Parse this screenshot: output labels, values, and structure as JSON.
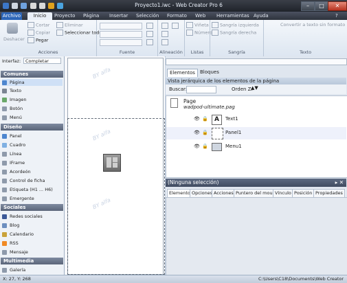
{
  "window": {
    "title": "Proyecto1.iwc - Web Creator Pro 6"
  },
  "menubar": {
    "file": "Archivo",
    "tabs": [
      "Inicio",
      "Proyecto",
      "Página",
      "Insertar",
      "Selección",
      "Formato",
      "Web",
      "Herramientas",
      "Ayuda"
    ]
  },
  "ribbon": {
    "deshacer": "Deshacer",
    "cortar": "Cortar",
    "copiar": "Copiar",
    "pegar": "Pegar",
    "eliminar": "Eliminar",
    "seleccionar_todo": "Seleccionar todo",
    "viñeta": "Viñeta",
    "numeros": "Números",
    "sangria_izq": "Sangría izquierda",
    "sangria_der": "Sangría derecha",
    "convertir": "Convertir a texto sin formato",
    "groups": [
      "Acciones",
      "Fuente",
      "Alineación",
      "Listas",
      "Sangría",
      "Texto"
    ]
  },
  "left": {
    "interface_label": "Interfaz:",
    "interface_value": "Completar",
    "categories": [
      {
        "name": "Comunes",
        "items": [
          "Página",
          "Texto",
          "Imagen",
          "Botón",
          "Menú"
        ]
      },
      {
        "name": "Diseño",
        "items": [
          "Panel",
          "Cuadro",
          "Línea",
          "IFrame",
          "Acordeón",
          "Control de ficha",
          "Etiqueta (H1 ... H6)",
          "Emergente"
        ]
      },
      {
        "name": "Sociales",
        "items": [
          "Redes sociales",
          "Blog",
          "Calendario",
          "RSS",
          "Mensaje"
        ]
      },
      {
        "name": "Multimedia",
        "items": [
          "Galería"
        ]
      }
    ]
  },
  "right": {
    "tabs": [
      "Elementos",
      "Bloques"
    ],
    "vista_title": "Vista jerárquica de los elementos de la página",
    "buscar_label": "Buscar:",
    "orden_label": "Orden Z:",
    "page_label": "Page",
    "page_file": "wadpod-ultimate.pag",
    "tree_items": [
      "Text1",
      "Panel1",
      "Menu1"
    ],
    "props_title": "(Ninguna selección)",
    "prop_tabs": [
      "Elemento",
      "Opciones",
      "Acciones",
      "Puntero del mouse",
      "Vínculo",
      "Posición",
      "Propiedades"
    ]
  },
  "watermark": "BY alfa",
  "status": {
    "coords": "X: 27, Y: 268",
    "path": "C:\\Users\\C18\\Documents\\Web Creator"
  },
  "colors": {
    "accent": "#2d66b8",
    "selection": "#cfe0f6",
    "category": "#5a6579"
  }
}
